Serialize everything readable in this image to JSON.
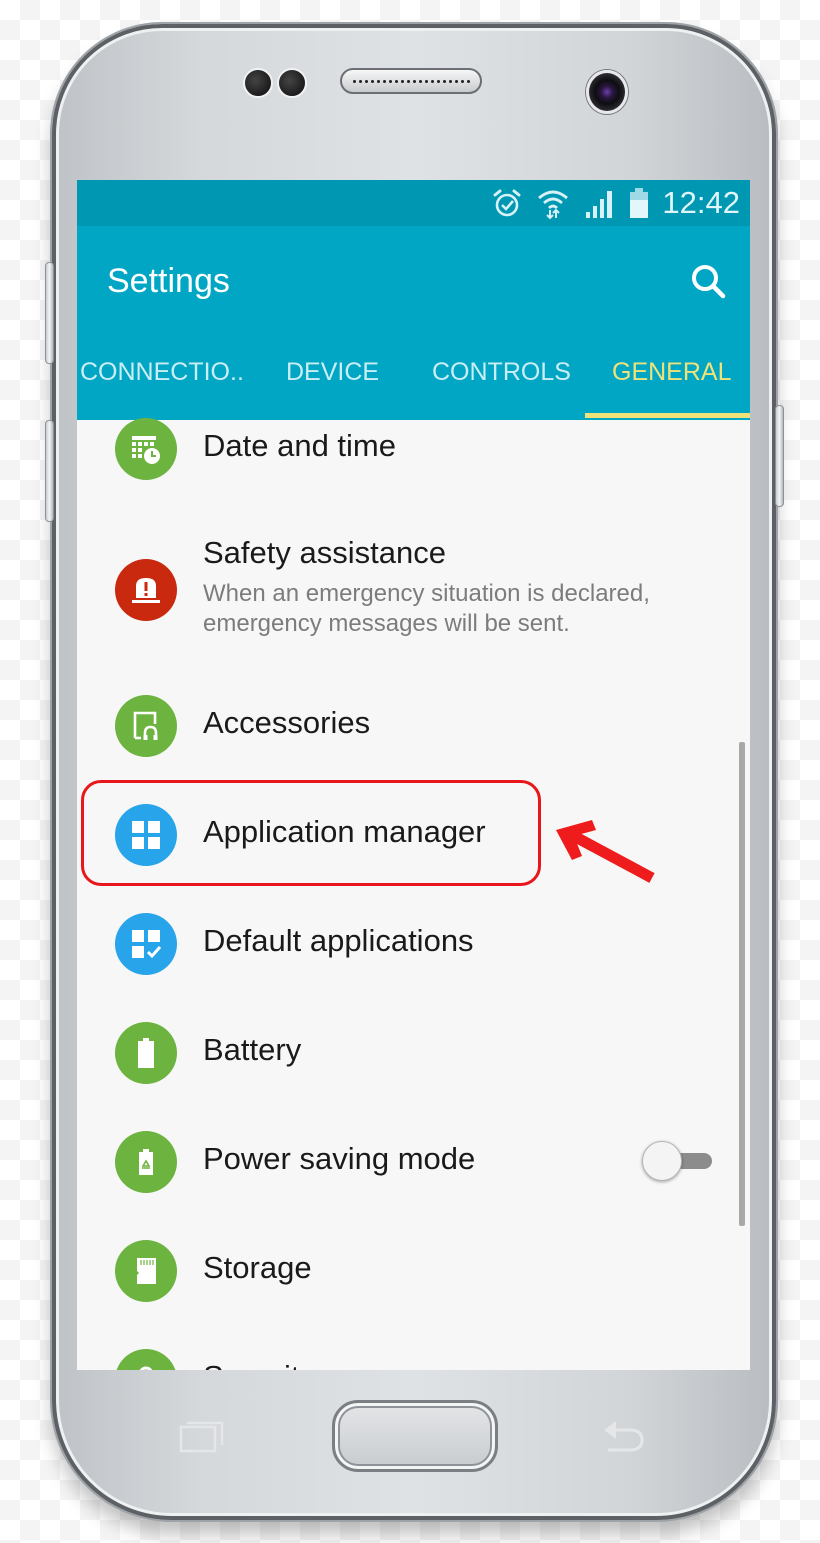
{
  "statusbar": {
    "icons": [
      "alarm-icon",
      "wifi-icon",
      "signal-icon",
      "battery-icon"
    ],
    "time": "12:42"
  },
  "appbar": {
    "title": "Settings",
    "search_icon": "search-icon"
  },
  "tabs": [
    {
      "label": "CONNECTIO..",
      "active": false
    },
    {
      "label": "DEVICE",
      "active": false
    },
    {
      "label": "CONTROLS",
      "active": false
    },
    {
      "label": "GENERAL",
      "active": true
    }
  ],
  "colors": {
    "statusbar": "#0097b2",
    "appbar": "#00a6c4",
    "tab_active": "#f0e27a",
    "icon_green": "#6db33f",
    "icon_red": "#c8290f",
    "icon_blue": "#28a4ea",
    "highlight": "#e8171b"
  },
  "settings_items": [
    {
      "label": "Date and time",
      "icon": "calendar-clock-icon",
      "color": "green"
    },
    {
      "label": "Safety assistance",
      "subtitle": "When an emergency situation is declared, emergency messages will be sent.",
      "subtitle_lines": [
        "When an emergency situation is declared,",
        "emergency messages will be sent."
      ],
      "icon": "siren-alert-icon",
      "color": "red"
    },
    {
      "label": "Accessories",
      "icon": "accessories-headphone-icon",
      "color": "green"
    },
    {
      "label": "Application manager",
      "icon": "app-grid-icon",
      "color": "blue",
      "highlighted": true
    },
    {
      "label": "Default applications",
      "icon": "app-grid-check-icon",
      "color": "blue"
    },
    {
      "label": "Battery",
      "icon": "battery-icon",
      "color": "green"
    },
    {
      "label": "Power saving mode",
      "icon": "battery-recycle-icon",
      "color": "green",
      "toggle": false
    },
    {
      "label": "Storage",
      "icon": "sd-card-icon",
      "color": "green"
    },
    {
      "label": "Security",
      "icon": "lock-icon",
      "color": "green",
      "partially_visible": true
    }
  ],
  "annotation": {
    "highlight_target": "Application manager",
    "arrow": "red-arrow-pointing-left"
  },
  "navigation": {
    "recent_apps": "recent-apps-icon",
    "home": "home-button",
    "back": "back-icon"
  }
}
